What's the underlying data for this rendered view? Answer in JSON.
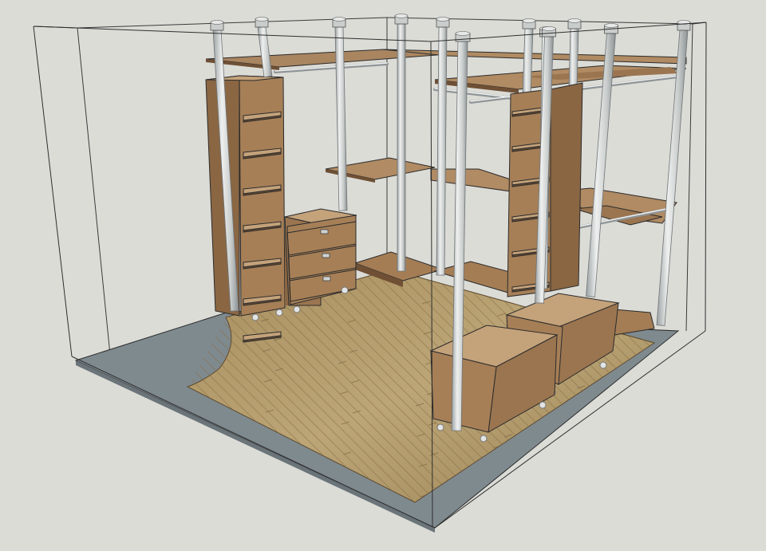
{
  "scene": {
    "subject": "walk-in-closet-3d-model",
    "colors": {
      "background": "#dcdcd7",
      "base_slab": "#7f8a8f",
      "floor_light": "#b39b6a",
      "floor_dark": "#8f7a52",
      "wood_front": "#a67f57",
      "wood_side": "#8a6643",
      "wood_top": "#c4a27a",
      "wood_shadow": "#6f5035",
      "pole": "#d5d8d7",
      "pole_edge": "#8f9496",
      "outline": "#2b2b2b"
    }
  }
}
